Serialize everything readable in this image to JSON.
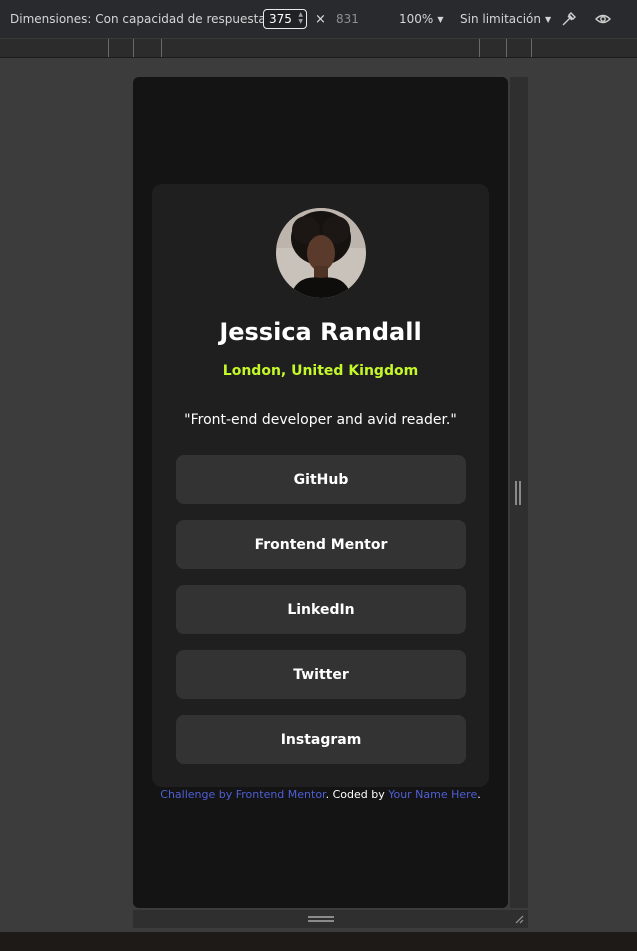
{
  "devtools": {
    "dimensions_label": "Dimensiones: Con capacidad de respuesta",
    "width_value": "375",
    "times": "×",
    "height_value": "831",
    "zoom": "100%",
    "throttle": "Sin limitación"
  },
  "profile": {
    "name": "Jessica Randall",
    "location": "London, United Kingdom",
    "bio": "\"Front-end developer and avid reader.\"",
    "links": [
      {
        "label": "GitHub"
      },
      {
        "label": "Frontend Mentor"
      },
      {
        "label": "LinkedIn"
      },
      {
        "label": "Twitter"
      },
      {
        "label": "Instagram"
      }
    ]
  },
  "attribution": {
    "challenge_text": "Challenge by Frontend Mentor",
    "coded_by": ". Coded by ",
    "author_text": "Your Name Here",
    "end": "."
  },
  "colors": {
    "accent": "#c4f82a",
    "card_bg": "#1f1f1f",
    "button_bg": "#333333",
    "page_bg": "#141414",
    "link": "#4f5fd6"
  },
  "icons": [
    "caret-down-icon",
    "eyedropper-icon",
    "eye-icon",
    "resize-grip-icon"
  ]
}
